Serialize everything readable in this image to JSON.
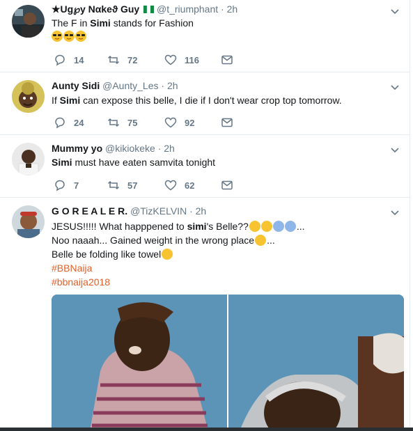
{
  "tweets": [
    {
      "name": "★Ug℘y Nαkeϑ Guy",
      "handle": "@t_riumphant",
      "time": "2h",
      "text_pre": "The F in ",
      "text_bold": "Simi",
      "text_post": " stands for Fashion",
      "replies": "14",
      "retweets": "72",
      "likes": "116"
    },
    {
      "name": "Aunty Sidi",
      "handle": "@Aunty_Les",
      "time": "2h",
      "text_pre": "If ",
      "text_bold": "Simi",
      "text_post": " can expose this belle, I die if I don't wear crop top tomorrow.",
      "replies": "24",
      "retweets": "75",
      "likes": "92"
    },
    {
      "name": "Mummy yo",
      "handle": "@kikiokeke",
      "time": "2h",
      "text_pre": "",
      "text_bold": "Simi",
      "text_post": " must have eaten samvita tonight",
      "replies": "7",
      "retweets": "57",
      "likes": "62"
    },
    {
      "name": "G O R E A L E R.",
      "handle": "@TizKELVIN",
      "time": "2h",
      "line1_pre": "JESUS!!!!! What happpened to ",
      "line1_bold": "simi",
      "line1_post": "'s  Belle??",
      "line1_end": "...",
      "line2_pre": "Noo naaah... Gained weight in the wrong place",
      "line2_end": "...",
      "line3_pre": "Belle be folding like towel",
      "hashtag1": "#BBNaija",
      "hashtag2": "#bbnaija2018"
    }
  ],
  "dot": "·",
  "colors": {
    "hashtag": "#e0602a",
    "meta": "#657786",
    "divider": "#e6ecf0"
  }
}
